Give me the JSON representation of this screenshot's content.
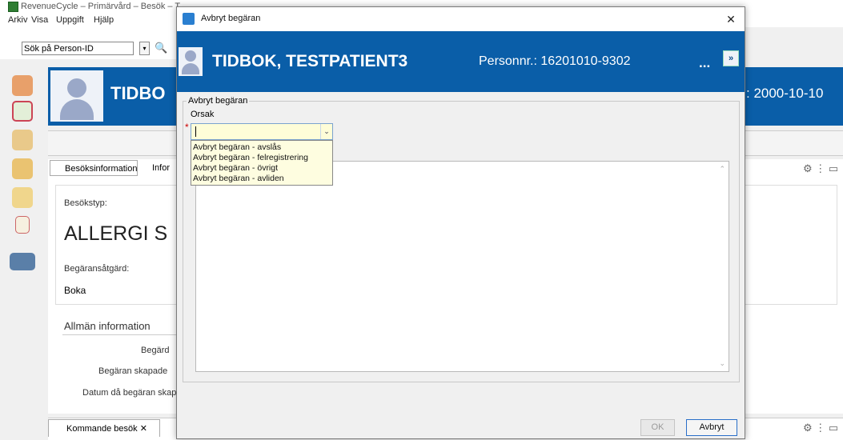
{
  "app": {
    "window_title": "RevenueCycle – Primärvård – Besök – T",
    "menu": [
      "Arkiv",
      "Visa",
      "Uppgift",
      "Hjälp"
    ],
    "search_placeholder": "Sök på Person-ID",
    "patient_name_partial": "TIDBO",
    "birth_date_partial": ": 2000-10-10",
    "tabs": {
      "besoksinformation": "Besöksinformation",
      "info_partial": "Infor"
    },
    "besokstyp_label": "Besökstyp:",
    "besokstyp_value": "ALLERGI S",
    "begaransatgard_label": "Begäransåtgärd:",
    "begaransatgard_value": "Boka",
    "allman_information": "Allmän information",
    "field_begard": "Begärd",
    "field_skapad": "Begäran skapade",
    "field_datum": "Datum då begäran skapa",
    "bottom_tab": "Kommande besök"
  },
  "dialog": {
    "title": "Avbryt begäran",
    "patient_name": "TIDBOK, TESTPATIENT3",
    "personnr_label": "Personnr.:",
    "personnr_value": "16201010-9302",
    "more": "...",
    "expand": "»",
    "group_label": "Avbryt begäran",
    "orsak_label": "Orsak",
    "required_marker": "*",
    "orsak_value": "",
    "options": [
      "Avbryt begäran - avslås",
      "Avbryt begäran - felregistrering",
      "Avbryt begäran - övrigt",
      "Avbryt begäran - avliden"
    ],
    "ok_label": "OK",
    "cancel_label": "Avbryt"
  },
  "colors": {
    "header_blue": "#0a5ea8",
    "combo_yellow": "#fefdd8",
    "required_red": "#cc0000"
  },
  "icons": [
    "app-logo-icon",
    "search-icon",
    "user-search-icon",
    "calendar-clock-icon",
    "clipboard-icon",
    "export-icon",
    "mail-icon",
    "checklist-icon",
    "building-icon",
    "close-icon",
    "person-icon"
  ]
}
